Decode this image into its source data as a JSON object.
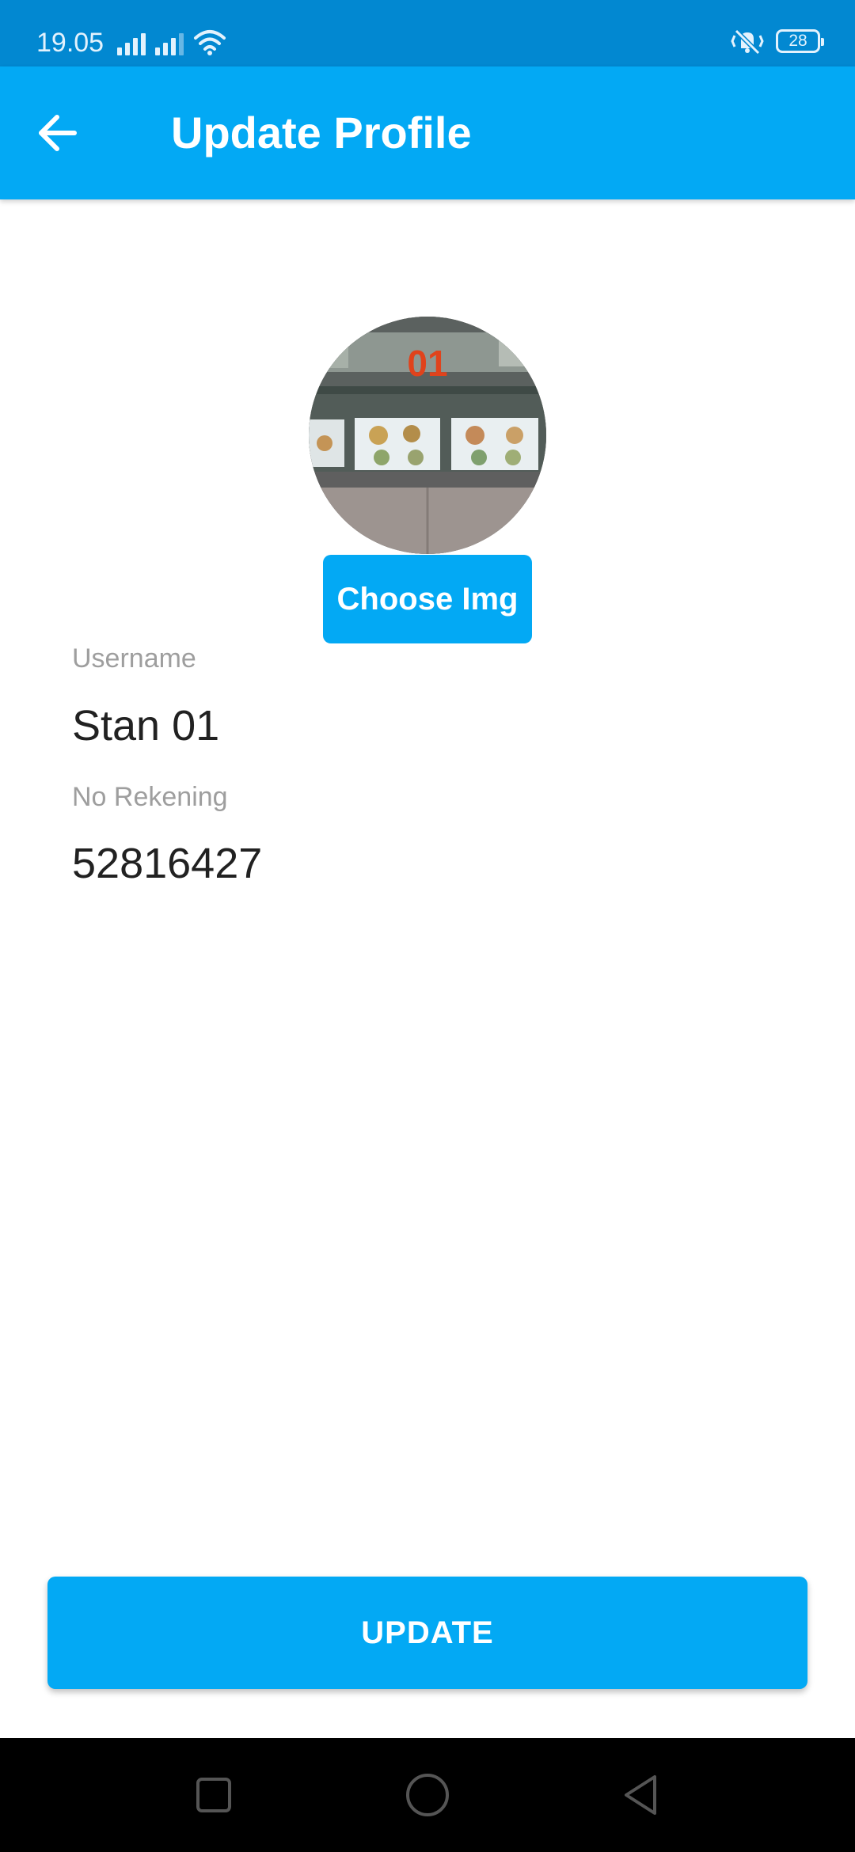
{
  "status_bar": {
    "time": "19.05",
    "battery_level": "28",
    "icons": [
      "signal-icon",
      "signal-icon",
      "wifi-icon",
      "vibrate-icon",
      "battery-icon"
    ]
  },
  "app_bar": {
    "title": "Update Profile",
    "back_icon": "arrow-back-icon"
  },
  "profile": {
    "image_caption": "01",
    "choose_image_label": "Choose Img"
  },
  "fields": {
    "username_label": "Username",
    "username_value": "Stan 01",
    "account_label": "No Rekening",
    "account_value": "52816427"
  },
  "actions": {
    "update_label": "UPDATE"
  },
  "navigation": {
    "icons": [
      "recent-apps-icon",
      "home-icon",
      "back-icon"
    ]
  },
  "colors": {
    "status_bar": "#0288d1",
    "primary": "#03a9f4",
    "label": "#9e9e9e",
    "text": "#212121"
  }
}
